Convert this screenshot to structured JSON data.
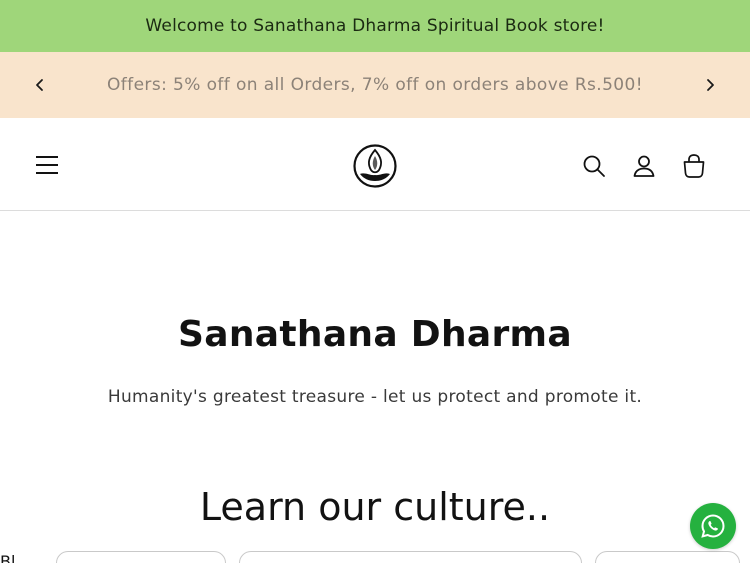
{
  "announcement": {
    "welcome_text": "Welcome to Sanathana Dharma Spiritual Book store!",
    "offer_text": "Offers: 5% off on all Orders, 7% off on orders above Rs.500!",
    "welcome_bg": "#9fd67a",
    "offer_bg": "#f9e4cc"
  },
  "header": {
    "menu_icon": "hamburger-menu-icon",
    "logo_icon": "lamp-logo-icon",
    "search_icon": "search-icon",
    "account_icon": "account-icon",
    "cart_icon": "cart-icon"
  },
  "hero": {
    "title": "Sanathana Dharma",
    "subtitle": "Humanity's greatest treasure - let us protect and promote it."
  },
  "section": {
    "title": "Learn our culture..",
    "partial_left_text": "Bl"
  },
  "floating": {
    "whatsapp_icon": "whatsapp-icon",
    "whatsapp_color": "#25b13f"
  }
}
